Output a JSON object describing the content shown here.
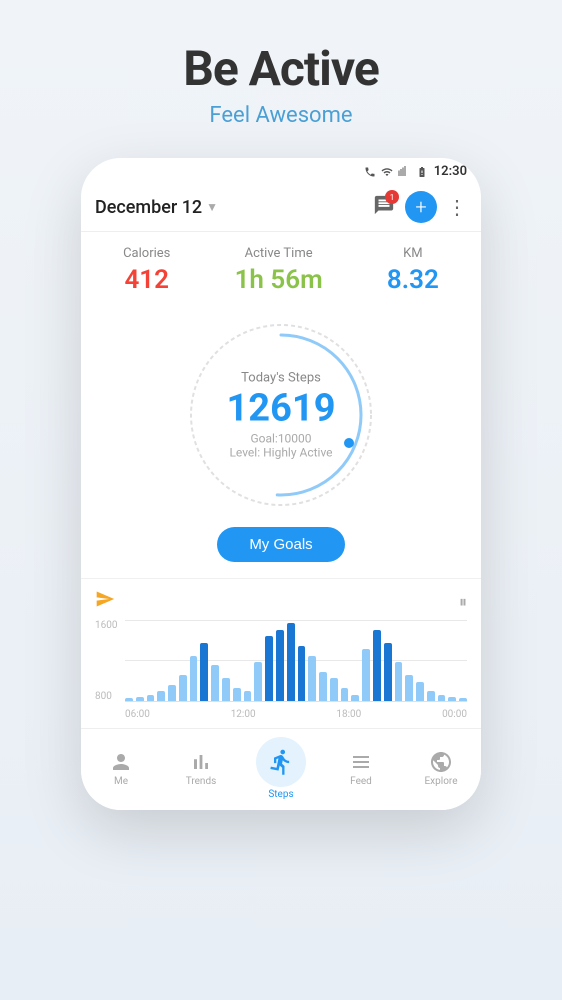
{
  "hero": {
    "title": "Be Active",
    "subtitle": "Feel Awesome"
  },
  "statusBar": {
    "time": "12:30",
    "icons": [
      "phone",
      "wifi",
      "signal",
      "battery"
    ]
  },
  "appBar": {
    "date": "December 12",
    "notification_count": "1"
  },
  "stats": {
    "calories": {
      "label": "Calories",
      "value": "412"
    },
    "activeTime": {
      "label": "Active Time",
      "value": "1h 56m"
    },
    "km": {
      "label": "KM",
      "value": "8.32"
    }
  },
  "steps": {
    "label": "Today's Steps",
    "value": "12619",
    "goal": "Goal:10000",
    "level": "Level: Highly Active"
  },
  "myGoalsBtn": "My Goals",
  "chart": {
    "yLabels": [
      "1600",
      "800"
    ],
    "xLabels": [
      "06:00",
      "12:00",
      "18:00",
      "00:00"
    ],
    "bars": [
      2,
      3,
      5,
      8,
      12,
      20,
      35,
      45,
      28,
      18,
      10,
      8,
      30,
      50,
      55,
      60,
      42,
      35,
      22,
      18,
      10,
      5,
      40,
      55,
      45,
      30,
      20,
      15,
      8,
      5,
      3,
      2
    ]
  },
  "nav": {
    "items": [
      {
        "label": "Me",
        "icon": "person"
      },
      {
        "label": "Trends",
        "icon": "bar_chart"
      },
      {
        "label": "Steps",
        "icon": "shoe",
        "active": true
      },
      {
        "label": "Feed",
        "icon": "feed"
      },
      {
        "label": "Explore",
        "icon": "explore"
      }
    ]
  },
  "addButton": "+",
  "moreButton": "⋮"
}
